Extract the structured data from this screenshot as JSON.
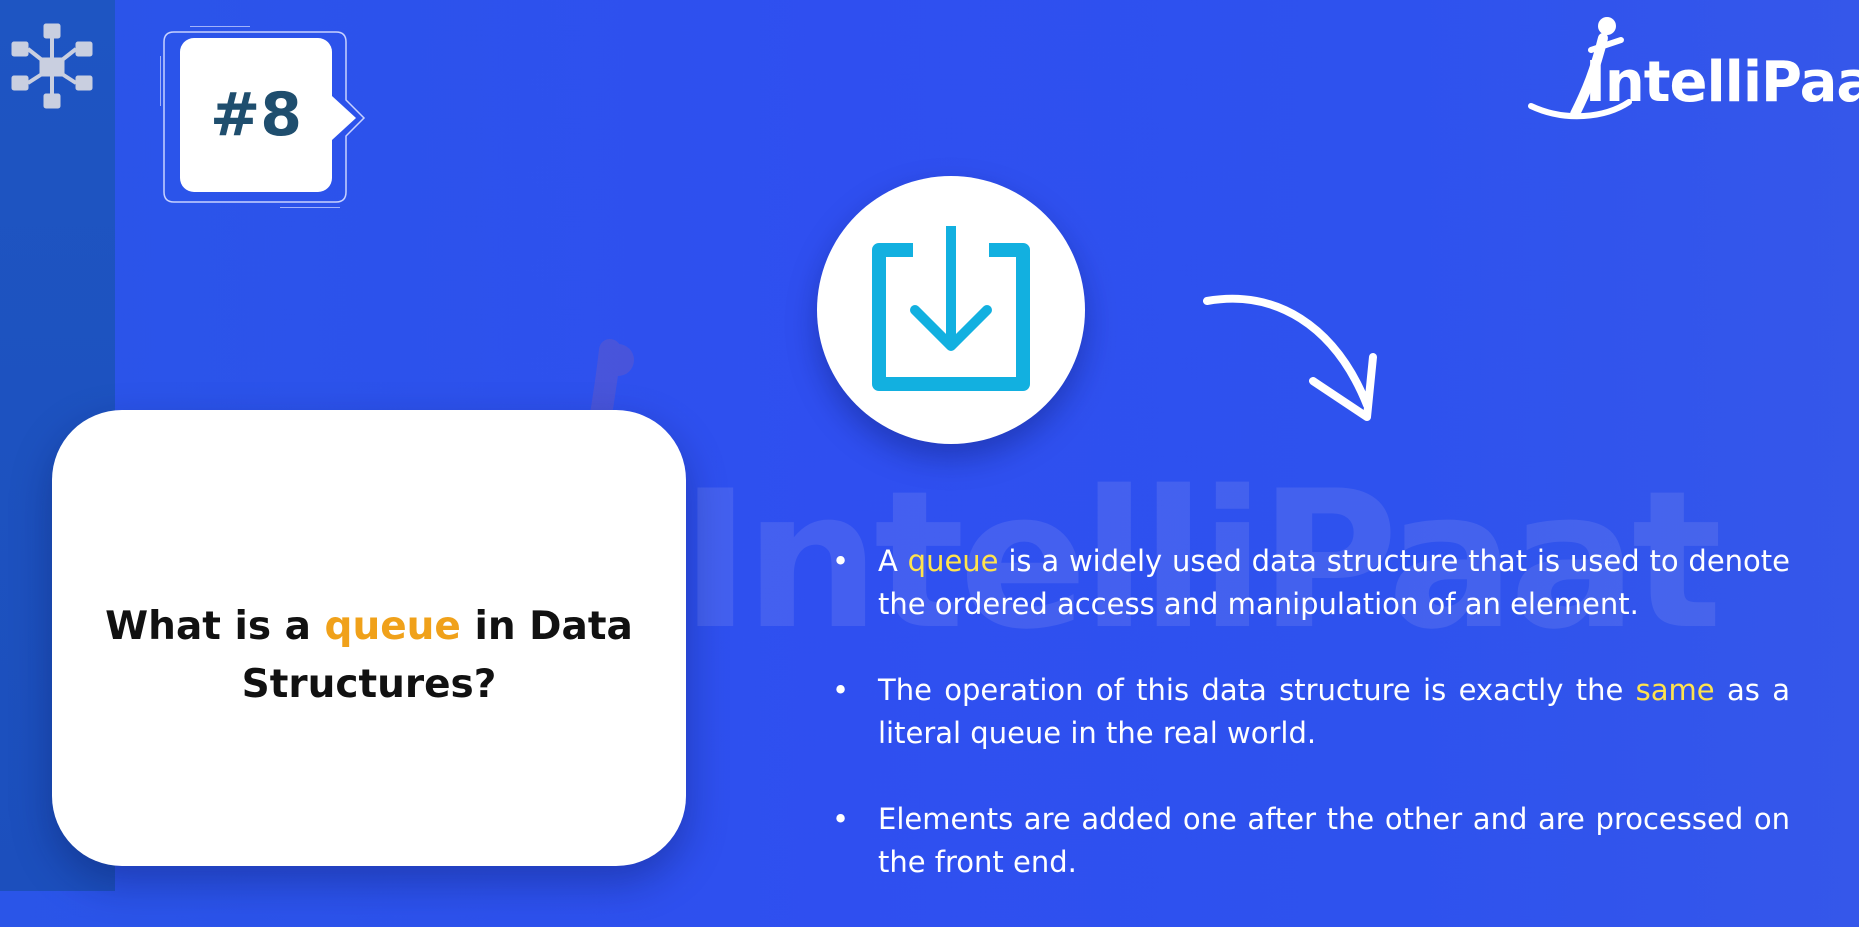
{
  "badge": {
    "label": "#8"
  },
  "logo": {
    "text": "IntelliPaat"
  },
  "watermark": {
    "text": "IntelliPaat"
  },
  "question": {
    "before": "What is a ",
    "highlight": "queue",
    "after": " in Data Structures?"
  },
  "bullets": [
    {
      "before": "A ",
      "highlight": "queue",
      "after": " is a widely used data structure that is used to denote the ordered access and manipulation of an element."
    },
    {
      "before": "The operation of this data structure is exactly the ",
      "highlight": "same",
      "after": " as a literal queue in the real world."
    },
    {
      "before": "Elements are added one after the other and are processed on the front end.",
      "highlight": "",
      "after": ""
    }
  ],
  "icons": {
    "network": "network-nodes-icon",
    "download": "download-icon",
    "arrow": "curved-arrow-icon"
  },
  "colors": {
    "background": "#2f4ff0",
    "question_highlight": "#f0a11a",
    "bullet_highlight": "#ffe34d",
    "badge_text": "#1f4e6e",
    "download_icon": "#12b0e0"
  }
}
